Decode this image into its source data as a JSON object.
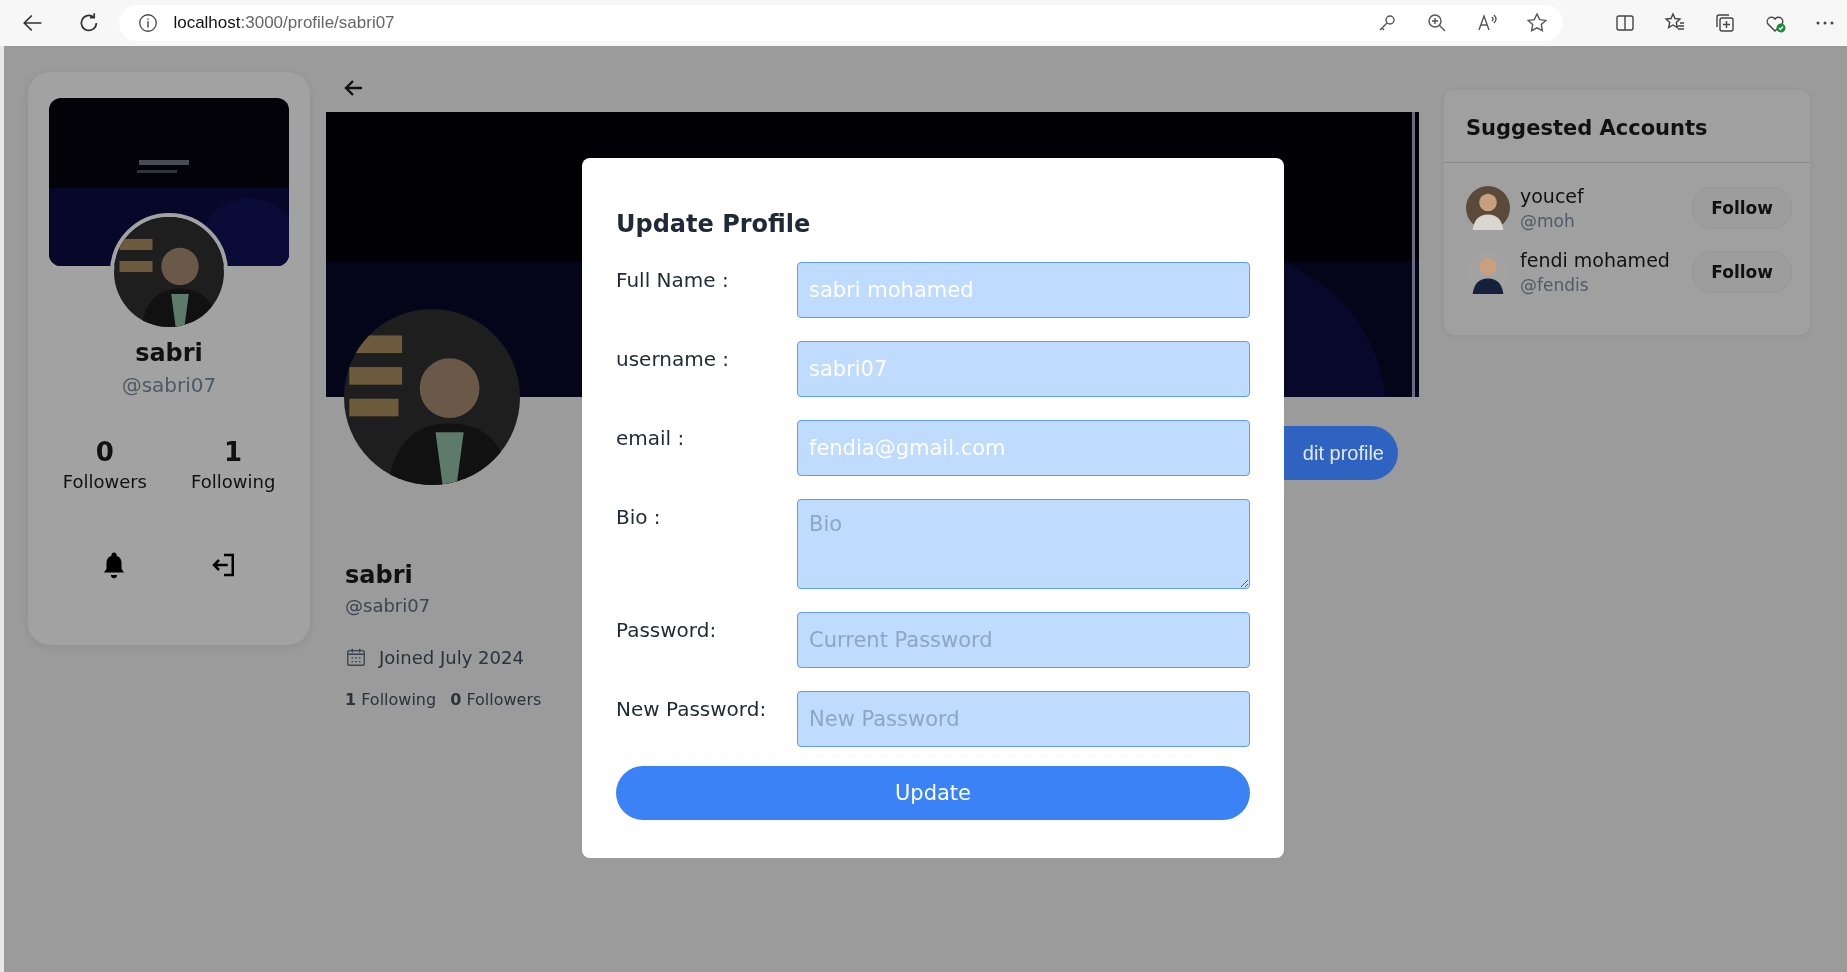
{
  "browser": {
    "url": "localhost:3000/profile/sabri07"
  },
  "sidebar": {
    "name": "sabri",
    "handle": "@sabri07",
    "stats": [
      {
        "value": "0",
        "label": "Followers"
      },
      {
        "value": "1",
        "label": "Following"
      }
    ]
  },
  "profile": {
    "name": "sabri",
    "handle": "@sabri07",
    "joined": "Joined July 2024",
    "counts": [
      "**1** Following",
      "**0** Followers"
    ],
    "edit_button": "dit profile"
  },
  "suggested": {
    "title": "Suggested Accounts",
    "accounts": [
      {
        "name": "youcef",
        "handle": "@moh",
        "button": "Follow"
      },
      {
        "name": "fendi mohamed",
        "handle": "@fendis",
        "button": "Follow"
      }
    ]
  },
  "modal": {
    "title": "Update Profile",
    "fields": [
      {
        "label": "Full Name :",
        "kind": "input",
        "value": "sabri mohamed"
      },
      {
        "label": "username :",
        "kind": "input",
        "value": "sabri07"
      },
      {
        "label": "email :",
        "kind": "input",
        "value": "fendia@gmail.com"
      },
      {
        "label": "Bio :",
        "kind": "textarea",
        "placeholder": "Bio"
      },
      {
        "label": "Password:",
        "kind": "input",
        "placeholder": "Current Password"
      },
      {
        "label": "New Password:",
        "kind": "input",
        "placeholder": "New Password"
      }
    ],
    "submit": "Update"
  }
}
